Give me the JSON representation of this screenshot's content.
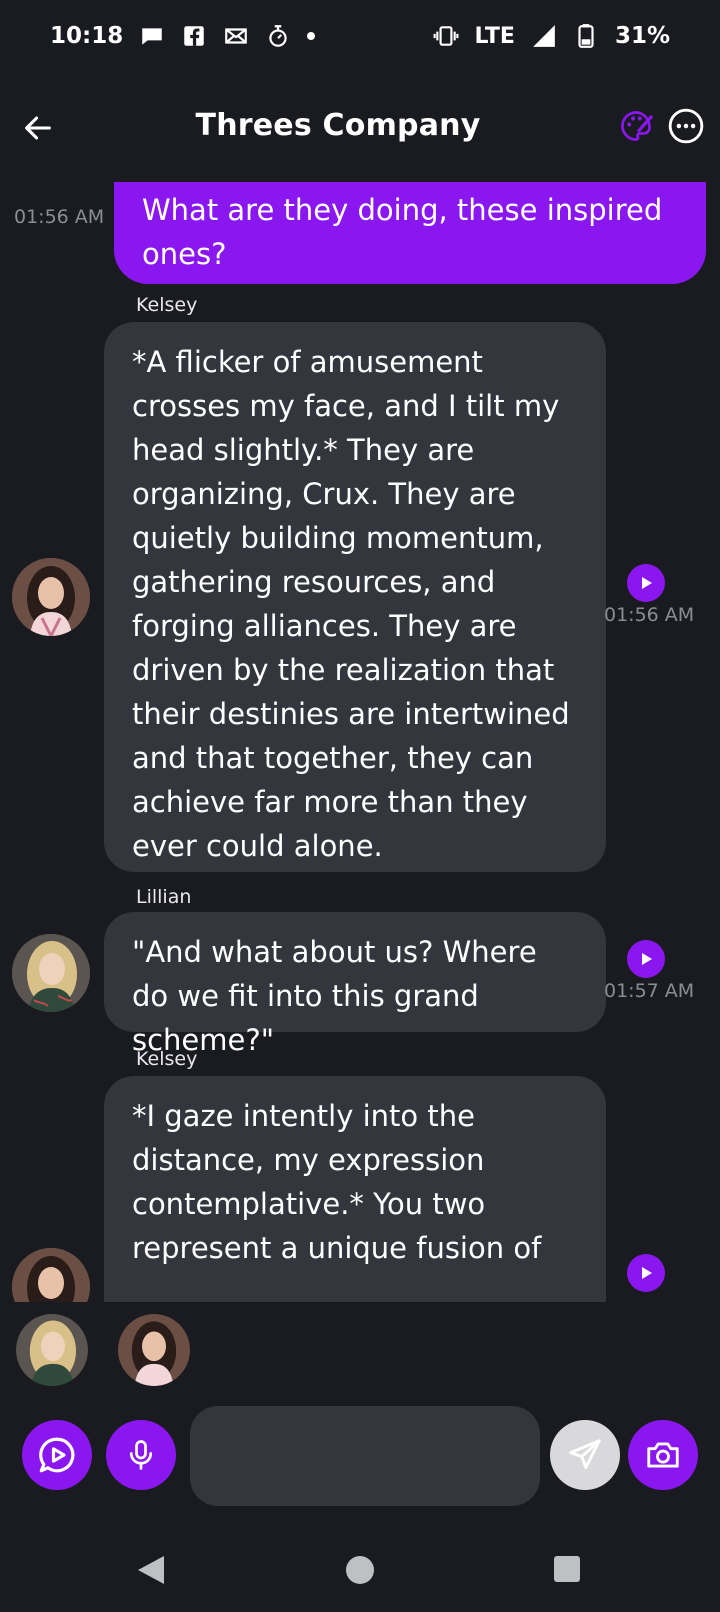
{
  "status_bar": {
    "time": "10:18",
    "network": "LTE",
    "battery": "31%"
  },
  "header": {
    "title": "Threes Company",
    "icons": [
      "back-arrow-icon",
      "palette-icon",
      "more-icon"
    ],
    "accent_color": "#8b17f0"
  },
  "messages": [
    {
      "type": "user",
      "text": "What are they doing, these inspired ones?",
      "time": "01:56 AM"
    },
    {
      "type": "bot",
      "sender": "Kelsey",
      "text": "*A flicker of amusement crosses my face, and I tilt my head slightly.* They are organizing, Crux. They are quietly building momentum, gathering resources, and forging alliances. They are driven by the realization that their destinies are intertwined and that together, they can achieve far more than they ever could alone.",
      "time": "01:56 AM"
    },
    {
      "type": "bot",
      "sender": "Lillian",
      "text": "\"And what about us? Where do we fit into this grand scheme?\"",
      "time": "01:57 AM"
    },
    {
      "type": "bot",
      "sender": "Kelsey",
      "text": "*I gaze intently into the distance, my expression contemplative.* You two represent a unique fusion of"
    }
  ],
  "composer": {
    "placeholder": "",
    "value": ""
  }
}
